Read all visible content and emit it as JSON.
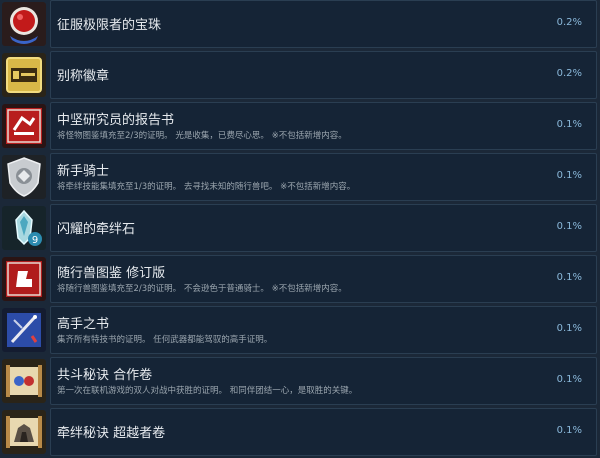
{
  "achievements": [
    {
      "title": "征服极限者的宝珠",
      "desc": "",
      "percent": "0.2%",
      "icon": "red-orb-icon"
    },
    {
      "title": "别称徽章",
      "desc": "",
      "percent": "0.2%",
      "icon": "gold-badge-icon"
    },
    {
      "title": "中坚研究员的报告书",
      "desc": "将怪物图鉴填充至2/3的证明。 光是收集，已费尽心思。 ※不包括新增内容。",
      "percent": "0.1%",
      "icon": "red-report-book-icon"
    },
    {
      "title": "新手骑士",
      "desc": "将牵绊技能集填充至1/3的证明。 去寻找未知的随行兽吧。 ※不包括新增内容。",
      "percent": "0.1%",
      "icon": "silver-shield-icon"
    },
    {
      "title": "闪耀的牵绊石",
      "desc": "",
      "percent": "0.1%",
      "icon": "kinship-stone-icon"
    },
    {
      "title": "随行兽图鉴 修订版",
      "desc": "将随行兽图鉴填充至2/3的证明。 不会逊色于普通骑士。 ※不包括新增内容。",
      "percent": "0.1%",
      "icon": "monstie-book-icon"
    },
    {
      "title": "高手之书",
      "desc": "集齐所有特技书的证明。 任何武器都能驾驭的高手证明。",
      "percent": "0.1%",
      "icon": "expert-book-icon"
    },
    {
      "title": "共斗秘诀 合作卷",
      "desc": "第一次在联机游戏的双人对战中获胜的证明。 和同伴团结一心，是取胜的关键。",
      "percent": "0.1%",
      "icon": "coop-scroll-icon"
    },
    {
      "title": "牵绊秘诀 超越者卷",
      "desc": "",
      "percent": "0.1%",
      "icon": "kinship-scroll-icon"
    }
  ]
}
